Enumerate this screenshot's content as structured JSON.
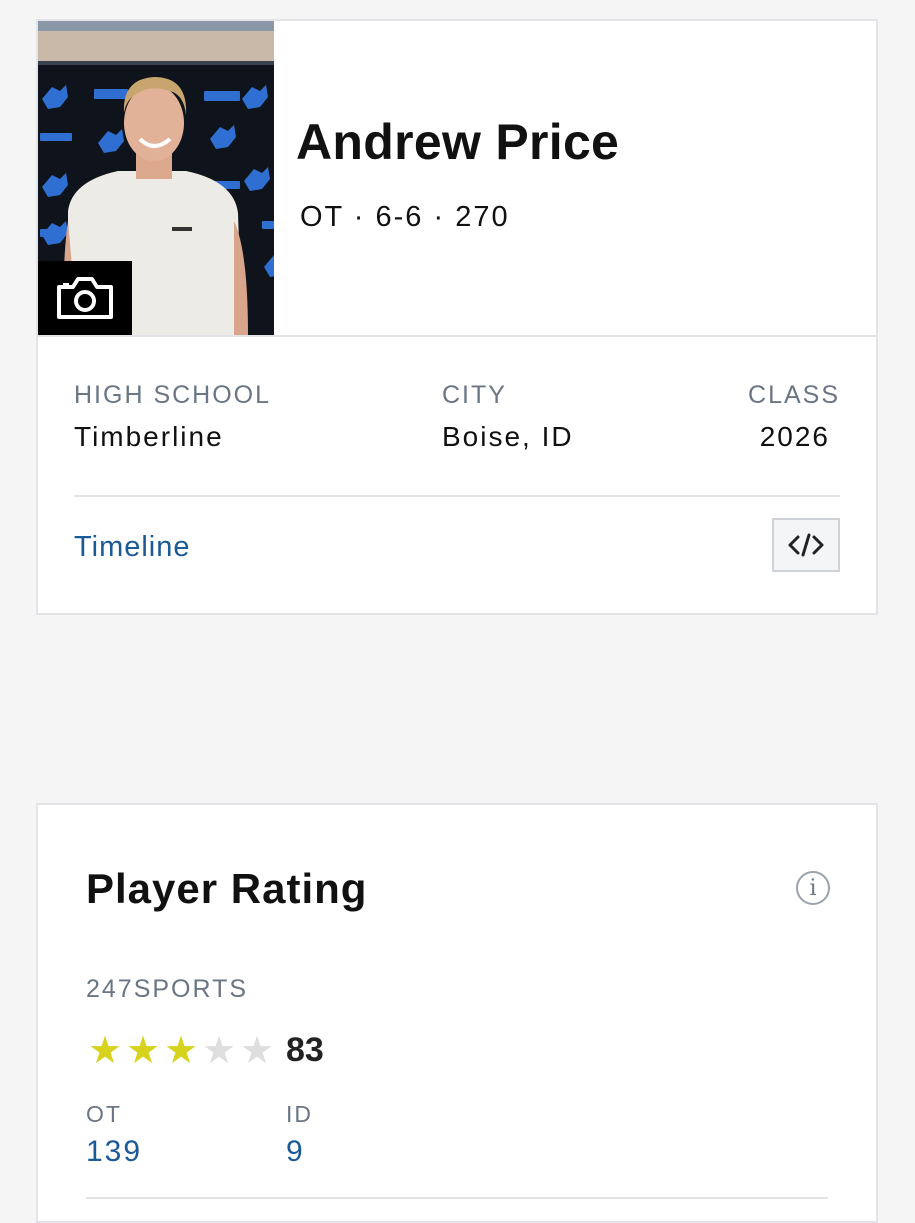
{
  "player": {
    "name": "Andrew Price",
    "vitals": "OT · 6-6 · 270"
  },
  "info": {
    "high_school_label": "HIGH SCHOOL",
    "high_school_value": "Timberline",
    "city_label": "CITY",
    "city_value": "Boise, ID",
    "class_label": "CLASS",
    "class_value": "2026"
  },
  "links": {
    "timeline": "Timeline"
  },
  "icons": {
    "camera": "camera-icon",
    "embed": "code-embed-icon",
    "info": "info-icon",
    "star": "star-icon"
  },
  "rating": {
    "title": "Player Rating",
    "info_glyph": "i",
    "source": "247SPORTS",
    "stars_filled": 3,
    "stars_total": 5,
    "score": "83",
    "position_label": "OT",
    "position_rank": "139",
    "state_label": "ID",
    "state_rank": "9"
  },
  "colors": {
    "link": "#1a5a96",
    "star_filled": "#d7d21c",
    "star_empty": "#dedede",
    "label": "#6a7685"
  }
}
